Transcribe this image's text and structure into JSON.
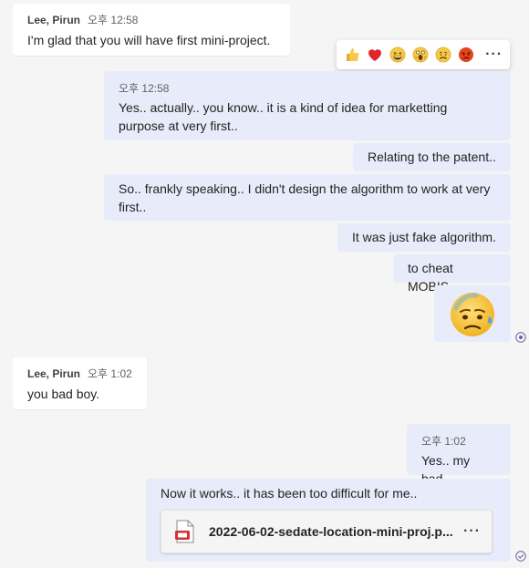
{
  "messages": {
    "m1": {
      "sender": "Lee, Pirun",
      "time": "오후 12:58",
      "text": "I'm glad that you will have first mini-project."
    },
    "m2": {
      "time": "오후 12:58",
      "text": "Yes.. actually.. you know.. it is a kind of idea for marketting purpose at very first.."
    },
    "m3": {
      "text": "Relating to the patent.."
    },
    "m4": {
      "text": "So.. frankly speaking.. I didn't design the algorithm to work at very first.."
    },
    "m5": {
      "text": "It was just fake algorithm."
    },
    "m6": {
      "text": "to cheat MOBIS"
    },
    "m7": {
      "emoji": "anxious-face-with-sweat"
    },
    "m8": {
      "sender": "Lee, Pirun",
      "time": "오후 1:02",
      "text": "you bad boy."
    },
    "m9": {
      "time": "오후 1:02",
      "text": "Yes.. my bad.."
    },
    "m10": {
      "text": "Now it works.. it has been too difficult for me..",
      "attachment": {
        "name": "2022-06-02-sedate-location-mini-proj.p...",
        "icon": "pdf-file-icon",
        "more": "···"
      }
    }
  },
  "reaction_bar": {
    "items": [
      "thumbs-up",
      "heart",
      "laughing",
      "surprised",
      "sad",
      "angry"
    ],
    "more": "···"
  },
  "colors": {
    "background": "#f5f5f5",
    "incoming": "#ffffff",
    "outgoing": "#e8ebfa",
    "accent": "#6264a7"
  }
}
